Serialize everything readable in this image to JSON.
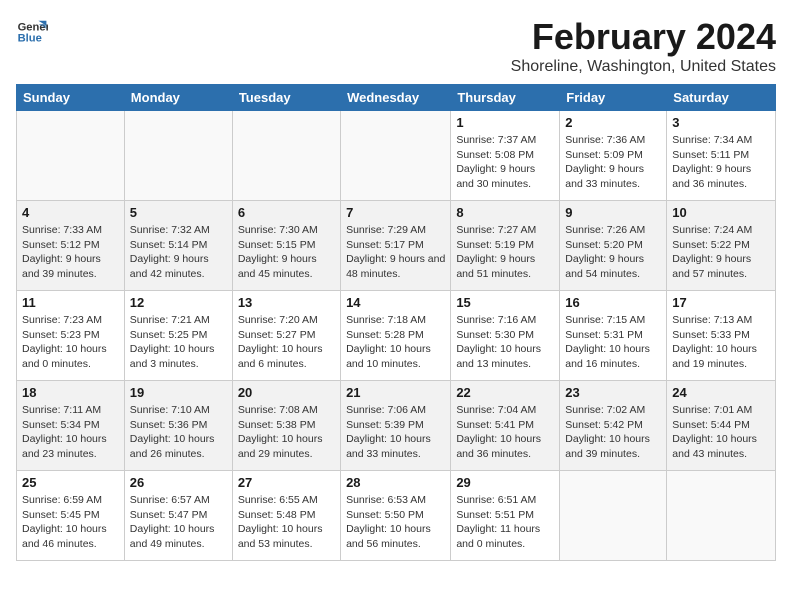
{
  "header": {
    "logo_general": "General",
    "logo_blue": "Blue",
    "title": "February 2024",
    "location": "Shoreline, Washington, United States"
  },
  "days_of_week": [
    "Sunday",
    "Monday",
    "Tuesday",
    "Wednesday",
    "Thursday",
    "Friday",
    "Saturday"
  ],
  "weeks": [
    [
      {
        "day": "",
        "info": ""
      },
      {
        "day": "",
        "info": ""
      },
      {
        "day": "",
        "info": ""
      },
      {
        "day": "",
        "info": ""
      },
      {
        "day": "1",
        "info": "Sunrise: 7:37 AM\nSunset: 5:08 PM\nDaylight: 9 hours and 30 minutes."
      },
      {
        "day": "2",
        "info": "Sunrise: 7:36 AM\nSunset: 5:09 PM\nDaylight: 9 hours and 33 minutes."
      },
      {
        "day": "3",
        "info": "Sunrise: 7:34 AM\nSunset: 5:11 PM\nDaylight: 9 hours and 36 minutes."
      }
    ],
    [
      {
        "day": "4",
        "info": "Sunrise: 7:33 AM\nSunset: 5:12 PM\nDaylight: 9 hours and 39 minutes."
      },
      {
        "day": "5",
        "info": "Sunrise: 7:32 AM\nSunset: 5:14 PM\nDaylight: 9 hours and 42 minutes."
      },
      {
        "day": "6",
        "info": "Sunrise: 7:30 AM\nSunset: 5:15 PM\nDaylight: 9 hours and 45 minutes."
      },
      {
        "day": "7",
        "info": "Sunrise: 7:29 AM\nSunset: 5:17 PM\nDaylight: 9 hours and 48 minutes."
      },
      {
        "day": "8",
        "info": "Sunrise: 7:27 AM\nSunset: 5:19 PM\nDaylight: 9 hours and 51 minutes."
      },
      {
        "day": "9",
        "info": "Sunrise: 7:26 AM\nSunset: 5:20 PM\nDaylight: 9 hours and 54 minutes."
      },
      {
        "day": "10",
        "info": "Sunrise: 7:24 AM\nSunset: 5:22 PM\nDaylight: 9 hours and 57 minutes."
      }
    ],
    [
      {
        "day": "11",
        "info": "Sunrise: 7:23 AM\nSunset: 5:23 PM\nDaylight: 10 hours and 0 minutes."
      },
      {
        "day": "12",
        "info": "Sunrise: 7:21 AM\nSunset: 5:25 PM\nDaylight: 10 hours and 3 minutes."
      },
      {
        "day": "13",
        "info": "Sunrise: 7:20 AM\nSunset: 5:27 PM\nDaylight: 10 hours and 6 minutes."
      },
      {
        "day": "14",
        "info": "Sunrise: 7:18 AM\nSunset: 5:28 PM\nDaylight: 10 hours and 10 minutes."
      },
      {
        "day": "15",
        "info": "Sunrise: 7:16 AM\nSunset: 5:30 PM\nDaylight: 10 hours and 13 minutes."
      },
      {
        "day": "16",
        "info": "Sunrise: 7:15 AM\nSunset: 5:31 PM\nDaylight: 10 hours and 16 minutes."
      },
      {
        "day": "17",
        "info": "Sunrise: 7:13 AM\nSunset: 5:33 PM\nDaylight: 10 hours and 19 minutes."
      }
    ],
    [
      {
        "day": "18",
        "info": "Sunrise: 7:11 AM\nSunset: 5:34 PM\nDaylight: 10 hours and 23 minutes."
      },
      {
        "day": "19",
        "info": "Sunrise: 7:10 AM\nSunset: 5:36 PM\nDaylight: 10 hours and 26 minutes."
      },
      {
        "day": "20",
        "info": "Sunrise: 7:08 AM\nSunset: 5:38 PM\nDaylight: 10 hours and 29 minutes."
      },
      {
        "day": "21",
        "info": "Sunrise: 7:06 AM\nSunset: 5:39 PM\nDaylight: 10 hours and 33 minutes."
      },
      {
        "day": "22",
        "info": "Sunrise: 7:04 AM\nSunset: 5:41 PM\nDaylight: 10 hours and 36 minutes."
      },
      {
        "day": "23",
        "info": "Sunrise: 7:02 AM\nSunset: 5:42 PM\nDaylight: 10 hours and 39 minutes."
      },
      {
        "day": "24",
        "info": "Sunrise: 7:01 AM\nSunset: 5:44 PM\nDaylight: 10 hours and 43 minutes."
      }
    ],
    [
      {
        "day": "25",
        "info": "Sunrise: 6:59 AM\nSunset: 5:45 PM\nDaylight: 10 hours and 46 minutes."
      },
      {
        "day": "26",
        "info": "Sunrise: 6:57 AM\nSunset: 5:47 PM\nDaylight: 10 hours and 49 minutes."
      },
      {
        "day": "27",
        "info": "Sunrise: 6:55 AM\nSunset: 5:48 PM\nDaylight: 10 hours and 53 minutes."
      },
      {
        "day": "28",
        "info": "Sunrise: 6:53 AM\nSunset: 5:50 PM\nDaylight: 10 hours and 56 minutes."
      },
      {
        "day": "29",
        "info": "Sunrise: 6:51 AM\nSunset: 5:51 PM\nDaylight: 11 hours and 0 minutes."
      },
      {
        "day": "",
        "info": ""
      },
      {
        "day": "",
        "info": ""
      }
    ]
  ]
}
